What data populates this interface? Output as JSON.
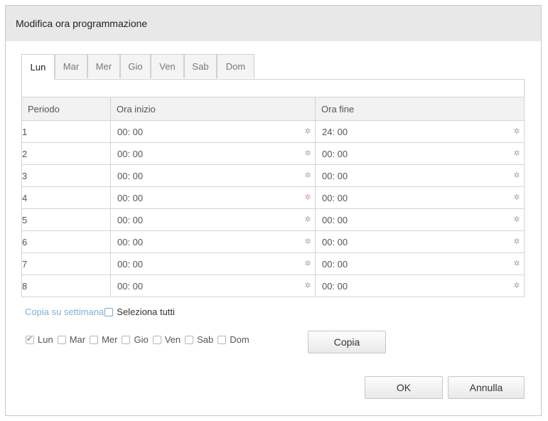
{
  "dialog": {
    "title": "Modifica ora programmazione"
  },
  "tabs": [
    "Lun",
    "Mar",
    "Mer",
    "Gio",
    "Ven",
    "Sab",
    "Dom"
  ],
  "active_tab": "Lun",
  "table": {
    "headers": [
      "Periodo",
      "Ora inizio",
      "Ora fine"
    ],
    "rows": [
      {
        "period": "1",
        "start": "00: 00",
        "end": "24: 00"
      },
      {
        "period": "2",
        "start": "00: 00",
        "end": "00: 00"
      },
      {
        "period": "3",
        "start": "00: 00",
        "end": "00: 00"
      },
      {
        "period": "4",
        "start": "00: 00",
        "end": "00: 00"
      },
      {
        "period": "5",
        "start": "00: 00",
        "end": "00: 00"
      },
      {
        "period": "6",
        "start": "00: 00",
        "end": "00: 00"
      },
      {
        "period": "7",
        "start": "00: 00",
        "end": "00: 00"
      },
      {
        "period": "8",
        "start": "00: 00",
        "end": "00: 00"
      }
    ],
    "time_icon": "clock-picker-icon"
  },
  "copy": {
    "link_label": "Copia su settimana",
    "select_all_label": "Seleziona tutti",
    "days": [
      {
        "label": "Lun",
        "checked": true
      },
      {
        "label": "Mar",
        "checked": false
      },
      {
        "label": "Mer",
        "checked": false
      },
      {
        "label": "Gio",
        "checked": false
      },
      {
        "label": "Ven",
        "checked": false
      },
      {
        "label": "Sab",
        "checked": false
      },
      {
        "label": "Dom",
        "checked": false
      }
    ],
    "copy_button": "Copia"
  },
  "buttons": {
    "ok": "OK",
    "cancel": "Annulla"
  },
  "colors": {
    "title_bar": "#e8e8e8",
    "link": "#7fb0d8",
    "border": "#d4d4d4"
  }
}
